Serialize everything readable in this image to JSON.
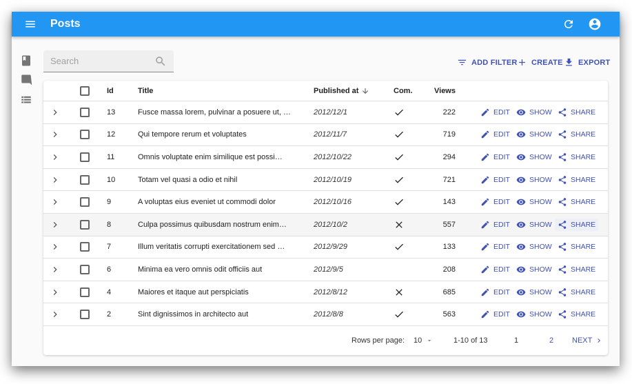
{
  "app": {
    "title": "Posts",
    "menu_icon": "menu-icon",
    "refresh_icon": "refresh-icon",
    "account_icon": "account-circle-icon",
    "accent": "#2196f3",
    "link_color": "#3f51b5"
  },
  "sidebar": {
    "items": [
      {
        "icon": "book-icon"
      },
      {
        "icon": "comment-icon"
      },
      {
        "icon": "list-icon"
      }
    ]
  },
  "search": {
    "placeholder": "Search",
    "value": ""
  },
  "toolbar": {
    "add_filter": "ADD FILTER",
    "create": "CREATE",
    "export": "EXPORT"
  },
  "table": {
    "headers": {
      "id": "Id",
      "title": "Title",
      "published_at": "Published at",
      "commentable": "Com.",
      "views": "Views"
    },
    "sort": {
      "column": "published_at",
      "direction": "desc"
    },
    "actions": {
      "edit": "EDIT",
      "show": "SHOW",
      "share": "SHARE"
    },
    "rows": [
      {
        "id": "13",
        "title": "Fusce massa lorem, pulvinar a posuere ut, …",
        "published_at": "2012/12/1",
        "commentable": true,
        "views": "222"
      },
      {
        "id": "12",
        "title": "Qui tempore rerum et voluptates",
        "published_at": "2012/11/7",
        "commentable": true,
        "views": "719"
      },
      {
        "id": "11",
        "title": "Omnis voluptate enim similique est possi…",
        "published_at": "2012/10/22",
        "commentable": true,
        "views": "294"
      },
      {
        "id": "10",
        "title": "Totam vel quasi a odio et nihil",
        "published_at": "2012/10/19",
        "commentable": true,
        "views": "721"
      },
      {
        "id": "9",
        "title": "A voluptas eius eveniet ut commodi dolor",
        "published_at": "2012/10/16",
        "commentable": true,
        "views": "143"
      },
      {
        "id": "8",
        "title": "Culpa possimus quibusdam nostrum enim…",
        "published_at": "2012/10/2",
        "commentable": false,
        "views": "557",
        "hovered": true
      },
      {
        "id": "7",
        "title": "Illum veritatis corrupti exercitationem sed …",
        "published_at": "2012/9/29",
        "commentable": true,
        "views": "133"
      },
      {
        "id": "6",
        "title": "Minima ea vero omnis odit officiis aut",
        "published_at": "2012/9/5",
        "commentable": null,
        "views": "208"
      },
      {
        "id": "4",
        "title": "Maiores et itaque aut perspiciatis",
        "published_at": "2012/8/12",
        "commentable": false,
        "views": "685"
      },
      {
        "id": "2",
        "title": "Sint dignissimos in architecto aut",
        "published_at": "2012/8/8",
        "commentable": true,
        "views": "563"
      }
    ]
  },
  "pagination": {
    "rows_per_page_label": "Rows per page:",
    "rows_per_page": "10",
    "range": "1-10 of 13",
    "pages": [
      "1",
      "2"
    ],
    "current_page": "1",
    "next": "NEXT"
  }
}
